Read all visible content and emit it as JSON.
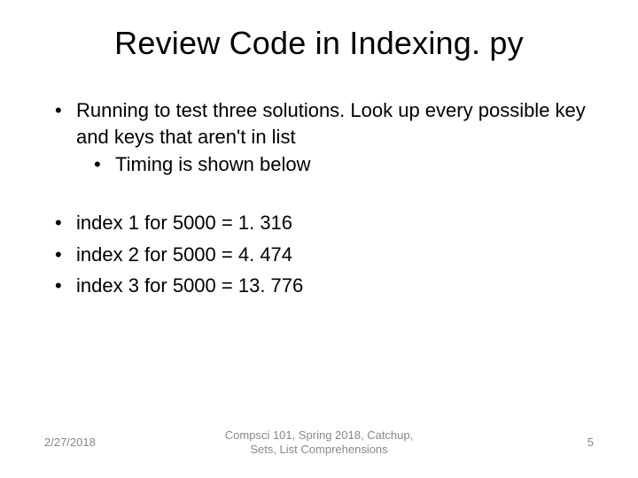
{
  "title": "Review Code in Indexing. py",
  "bullets": {
    "b1": "Running to test three solutions. Look up every possible key and keys that aren't in list",
    "b1_sub": "Timing is shown below"
  },
  "results": {
    "r1": "index 1 for 5000 = 1. 316",
    "r2": "index 2 for 5000 = 4. 474",
    "r3": "index 3 for 5000 = 13. 776"
  },
  "footer": {
    "date": "2/27/2018",
    "center_line1": "Compsci 101, Spring 2018,  Catchup,",
    "center_line2": "Sets, List Comprehensions",
    "page": "5"
  }
}
